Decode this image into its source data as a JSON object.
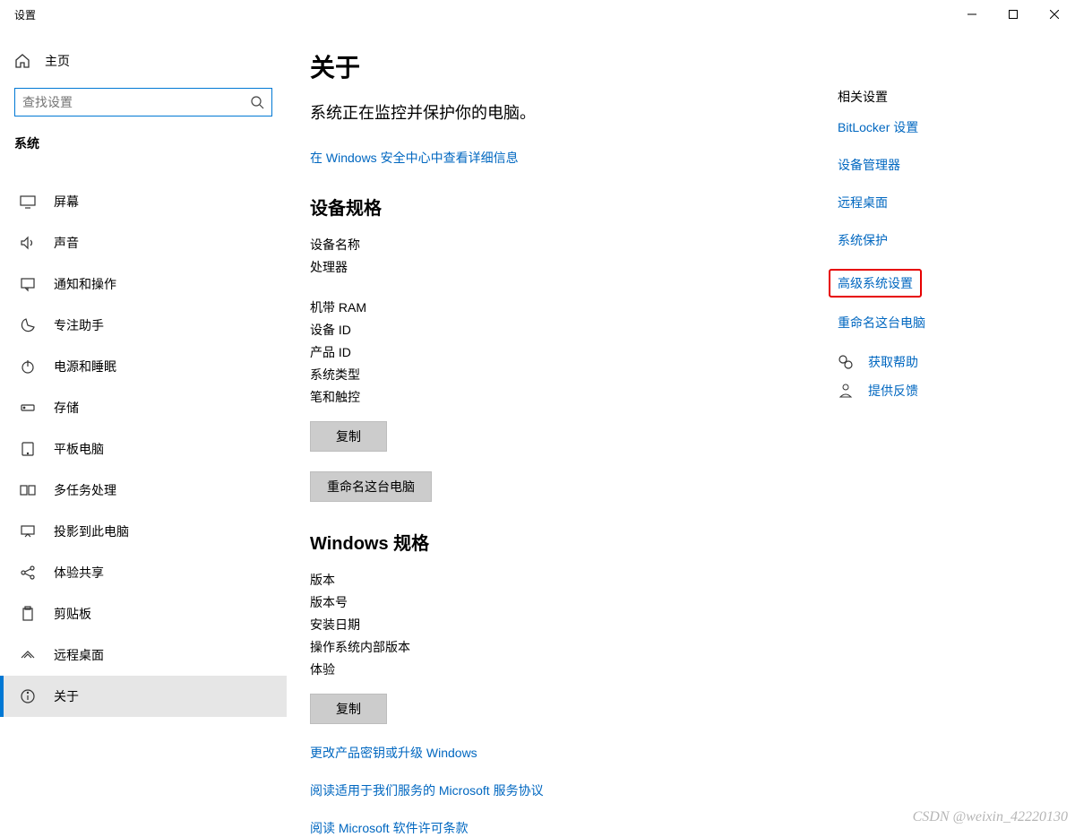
{
  "window": {
    "title": "设置"
  },
  "sidebar": {
    "home_label": "主页",
    "search_placeholder": "查找设置",
    "category": "系统",
    "items": [
      {
        "label": "屏幕",
        "icon": "display"
      },
      {
        "label": "声音",
        "icon": "sound"
      },
      {
        "label": "通知和操作",
        "icon": "notifications"
      },
      {
        "label": "专注助手",
        "icon": "focus"
      },
      {
        "label": "电源和睡眠",
        "icon": "power"
      },
      {
        "label": "存储",
        "icon": "storage"
      },
      {
        "label": "平板电脑",
        "icon": "tablet"
      },
      {
        "label": "多任务处理",
        "icon": "multitask"
      },
      {
        "label": "投影到此电脑",
        "icon": "project"
      },
      {
        "label": "体验共享",
        "icon": "share"
      },
      {
        "label": "剪贴板",
        "icon": "clipboard"
      },
      {
        "label": "远程桌面",
        "icon": "remote"
      },
      {
        "label": "关于",
        "icon": "about",
        "active": true
      }
    ]
  },
  "main": {
    "title": "关于",
    "protection_msg": "系统正在监控并保护你的电脑。",
    "security_link": "在 Windows 安全中心中查看详细信息",
    "device_spec_title": "设备规格",
    "device_specs": [
      "设备名称",
      "处理器",
      "机带 RAM",
      "设备 ID",
      "产品 ID",
      "系统类型",
      "笔和触控"
    ],
    "copy_label": "复制",
    "rename_label": "重命名这台电脑",
    "windows_spec_title": "Windows 规格",
    "windows_specs": [
      "版本",
      "版本号",
      "安装日期",
      "操作系统内部版本",
      "体验"
    ],
    "copy2_label": "复制",
    "link_change_key": "更改产品密钥或升级 Windows",
    "link_service_terms": "阅读适用于我们服务的 Microsoft 服务协议",
    "link_license": "阅读 Microsoft 软件许可条款"
  },
  "right": {
    "header": "相关设置",
    "links": [
      "BitLocker 设置",
      "设备管理器",
      "远程桌面",
      "系统保护",
      "高级系统设置",
      "重命名这台电脑"
    ],
    "help": "获取帮助",
    "feedback": "提供反馈"
  },
  "watermark": "CSDN @weixin_42220130"
}
